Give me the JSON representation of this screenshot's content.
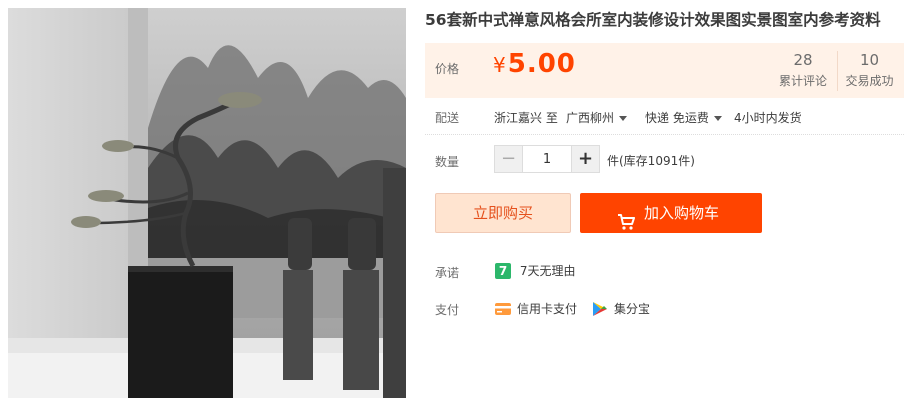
{
  "product": {
    "title": "56套新中式禅意风格会所室内装修设计效果图实景图室内参考资料"
  },
  "price": {
    "label": "价格",
    "currency": "¥",
    "value": "5.00"
  },
  "stats": {
    "reviews_count": "28",
    "reviews_label": "累计评论",
    "sales_count": "10",
    "sales_label": "交易成功"
  },
  "shipping": {
    "label": "配送",
    "from": "浙江嘉兴 至",
    "to": "广西柳州",
    "method": "快递 免运费",
    "dispatch": "4小时内发货"
  },
  "quantity": {
    "label": "数量",
    "value": "1",
    "minus": "−",
    "plus": "+",
    "stock_text": "件(库存1091件)"
  },
  "actions": {
    "buy_now": "立即购买",
    "add_to_cart": "加入购物车"
  },
  "promise": {
    "label": "承诺",
    "badge": "7",
    "text": "7天无理由"
  },
  "payment": {
    "label": "支付",
    "methods": [
      "信用卡支付",
      "集分宝"
    ]
  },
  "colors": {
    "accent": "#ff4400",
    "price_bg": "#fff2e8",
    "buy_now_bg": "#ffe4d0",
    "promise_green": "#2cb76b"
  },
  "icons": {
    "cart": "cart-icon",
    "credit_card": "credit-card-icon",
    "jifenbao": "jifenbao-icon",
    "shipping_caret": "chevron-down-icon"
  }
}
